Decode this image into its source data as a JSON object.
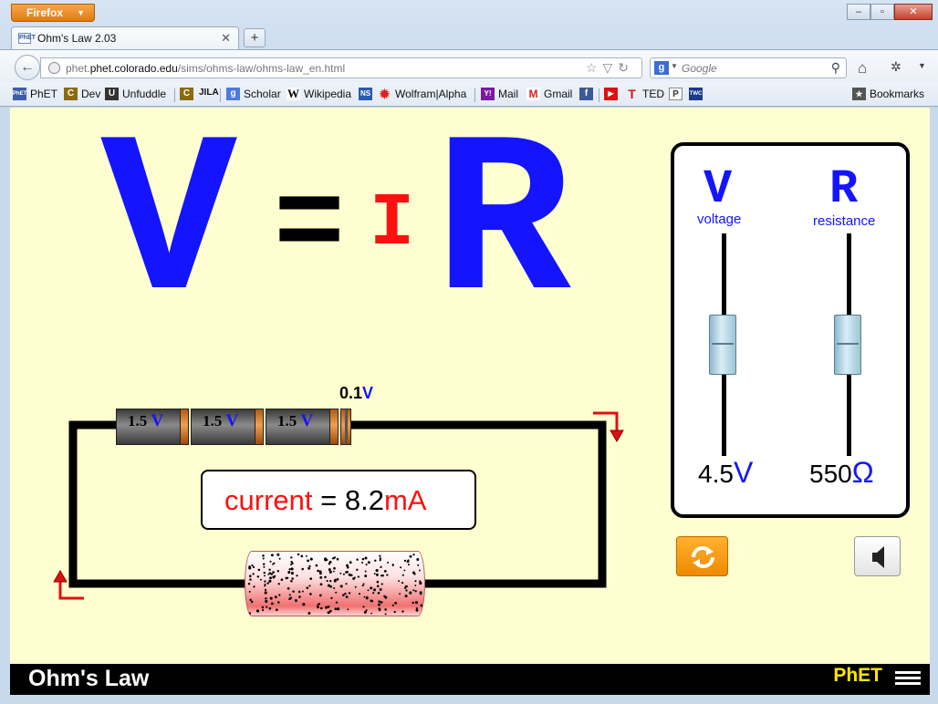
{
  "browser": {
    "menu_button": "Firefox",
    "tab_title": "Ohm's Law 2.03",
    "url_host": "phet.colorado.edu",
    "url_path": "/sims/ohms-law/ohms-law_en.html",
    "search_placeholder": "Google",
    "bookmarks": [
      "PhET",
      "Dev",
      "Unfuddle",
      "JILA",
      "Scholar",
      "Wikipedia",
      "Wolfram|Alpha",
      "Mail",
      "Gmail",
      "TED",
      "Bookmarks"
    ]
  },
  "equation": {
    "v": "V",
    "equals": "=",
    "i": "I",
    "r": "R"
  },
  "batteries": [
    {
      "value": "1.5",
      "unit": "V"
    },
    {
      "value": "1.5",
      "unit": "V"
    },
    {
      "value": "1.5",
      "unit": "V"
    }
  ],
  "partial_battery": {
    "value": "0.1",
    "unit": "V"
  },
  "current": {
    "label": "current",
    "equals": "=",
    "value": "8.2",
    "unit": "mA"
  },
  "controls": {
    "voltage": {
      "symbol": "V",
      "label": "voltage",
      "value": "4.5",
      "unit": "V",
      "level": 0.5
    },
    "resistance": {
      "symbol": "R",
      "label": "resistance",
      "value": "550",
      "unit": "Ω",
      "level": 0.5
    }
  },
  "footer": {
    "sim_title": "Ohm's Law",
    "logo": "PhET"
  },
  "colors": {
    "blue": "#1414ff",
    "red": "#ff1010",
    "background": "#fffed0",
    "reset_orange": "#f5960a"
  }
}
